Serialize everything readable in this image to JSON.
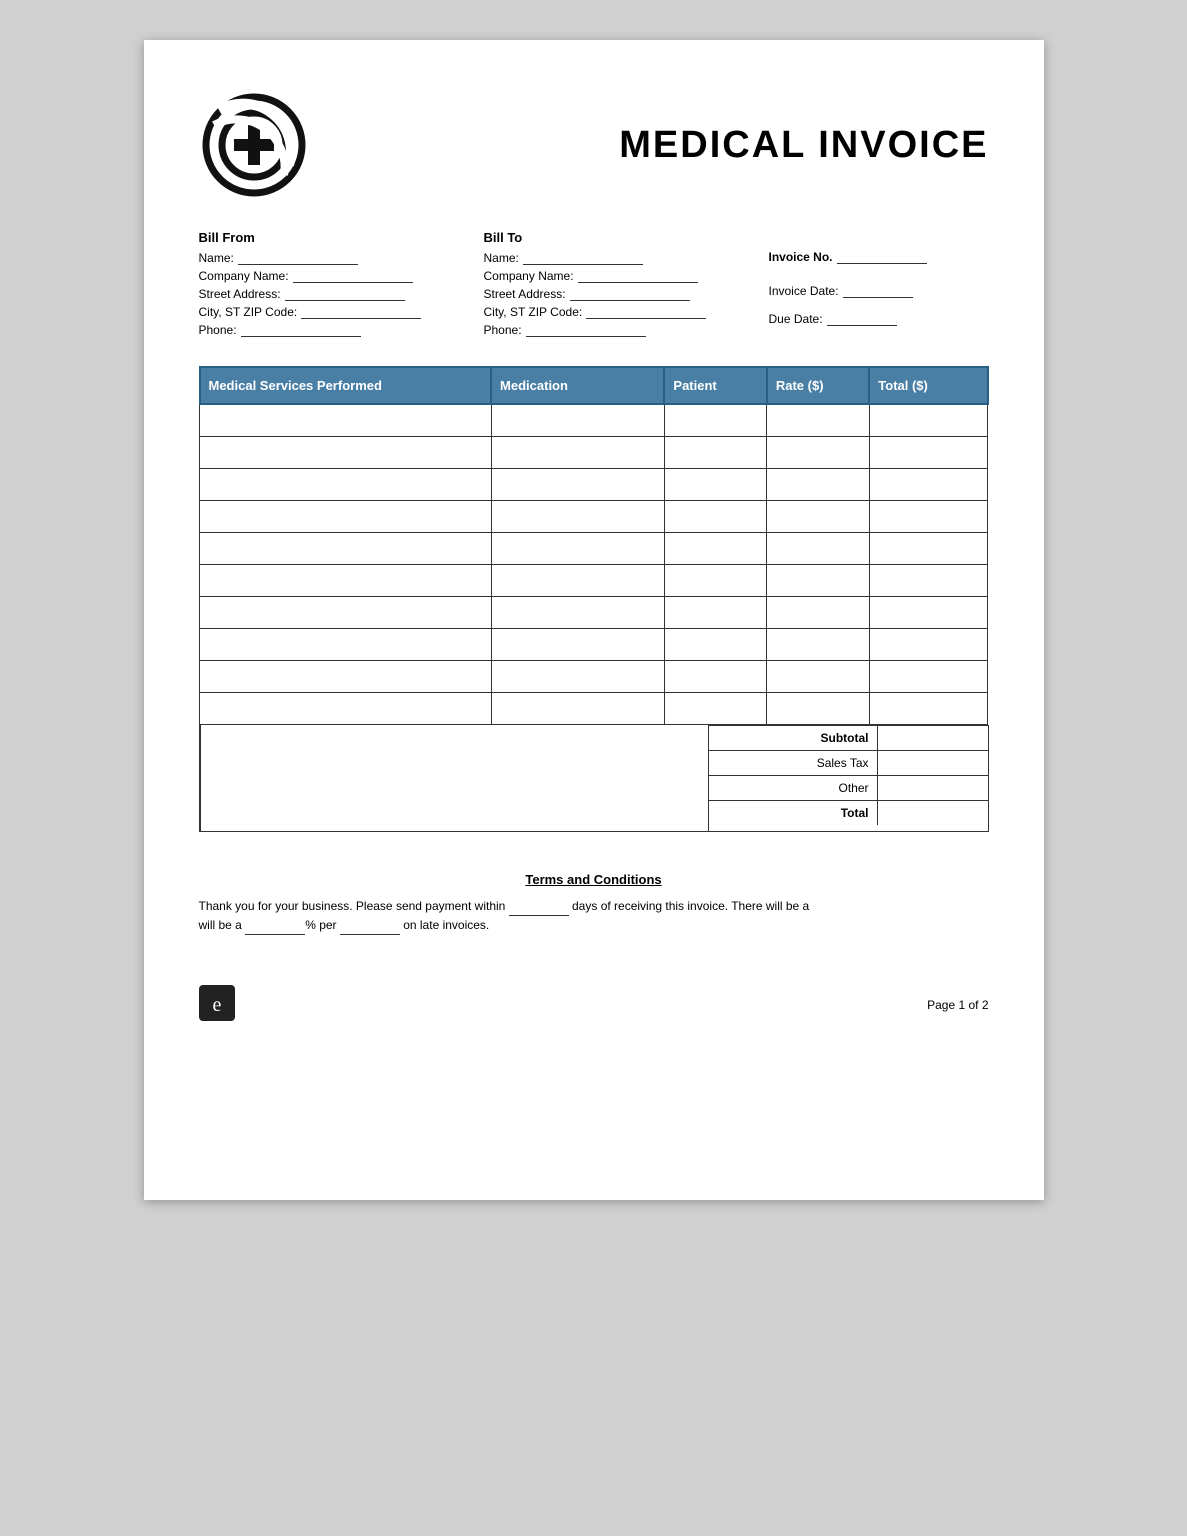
{
  "page": {
    "title": "MEDICAL INVOICE",
    "logo_alt": "Medical cross logo"
  },
  "bill_from": {
    "heading": "Bill From",
    "fields": [
      {
        "label": "Name:",
        "value": ""
      },
      {
        "label": "Company Name:",
        "value": ""
      },
      {
        "label": "Street Address:",
        "value": ""
      },
      {
        "label": "City, ST ZIP Code:",
        "value": ""
      },
      {
        "label": "Phone:",
        "value": ""
      }
    ]
  },
  "bill_to": {
    "heading": "Bill To",
    "fields": [
      {
        "label": "Name:",
        "value": ""
      },
      {
        "label": "Company Name:",
        "value": ""
      },
      {
        "label": "Street Address:",
        "value": ""
      },
      {
        "label": "City, ST ZIP Code:",
        "value": ""
      },
      {
        "label": "Phone:",
        "value": ""
      }
    ]
  },
  "invoice_meta": {
    "invoice_no_label": "Invoice No.",
    "invoice_date_label": "Invoice Date:",
    "due_date_label": "Due Date:"
  },
  "table": {
    "headers": [
      "Medical Services Performed",
      "Medication",
      "Patient",
      "Rate ($)",
      "Total ($)"
    ],
    "rows": 10
  },
  "summary": {
    "rows": [
      {
        "label": "Subtotal",
        "bold": true
      },
      {
        "label": "Sales Tax",
        "bold": false
      },
      {
        "label": "Other",
        "bold": false
      },
      {
        "label": "Total",
        "bold": true
      }
    ]
  },
  "terms": {
    "title": "Terms and Conditions",
    "body_prefix": "Thank you for your business. Please send payment within",
    "body_middle": "days of receiving this invoice. There will be a",
    "body_suffix": "% per",
    "body_end": "on late invoices."
  },
  "footer": {
    "page_text": "Page 1 of 2"
  },
  "colors": {
    "table_header_bg": "#4a7fa5",
    "table_header_text": "#ffffff",
    "table_border": "#333333"
  }
}
